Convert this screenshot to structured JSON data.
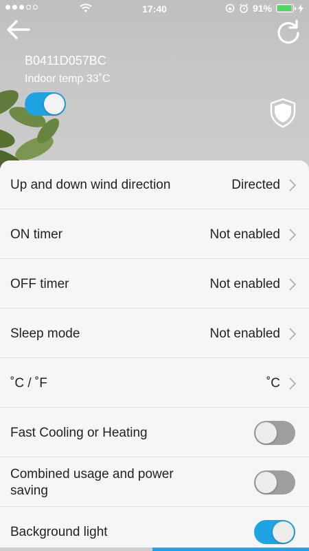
{
  "status_bar": {
    "time": "17:40",
    "battery_percent": "91%",
    "battery_level": 0.91
  },
  "device": {
    "id": "B0411D057BC",
    "indoor_temp": "Indoor temp 33˚C",
    "power_on": true
  },
  "settings": {
    "wind_direction": {
      "label": "Up and down wind direction",
      "value": "Directed"
    },
    "on_timer": {
      "label": "ON timer",
      "value": "Not enabled"
    },
    "off_timer": {
      "label": "OFF timer",
      "value": "Not enabled"
    },
    "sleep_mode": {
      "label": "Sleep mode",
      "value": "Not enabled"
    },
    "temp_unit": {
      "label": "˚C / ˚F",
      "value": "˚C"
    },
    "fast_cooling": {
      "label": "Fast Cooling or Heating",
      "enabled": false
    },
    "combined_usage": {
      "label": "Combined usage and power saving",
      "enabled": false
    },
    "background_light": {
      "label": "Background light",
      "enabled": true
    }
  },
  "colors": {
    "accent": "#1ea3e3",
    "toggle_off": "#9e9e9e",
    "battery_fill": "#4cd964"
  },
  "icons": [
    "back-arrow-icon",
    "refresh-icon",
    "shield-icon",
    "chevron-right-icon",
    "wifi-icon",
    "alarm-icon",
    "lock-rotation-icon",
    "charging-icon"
  ]
}
